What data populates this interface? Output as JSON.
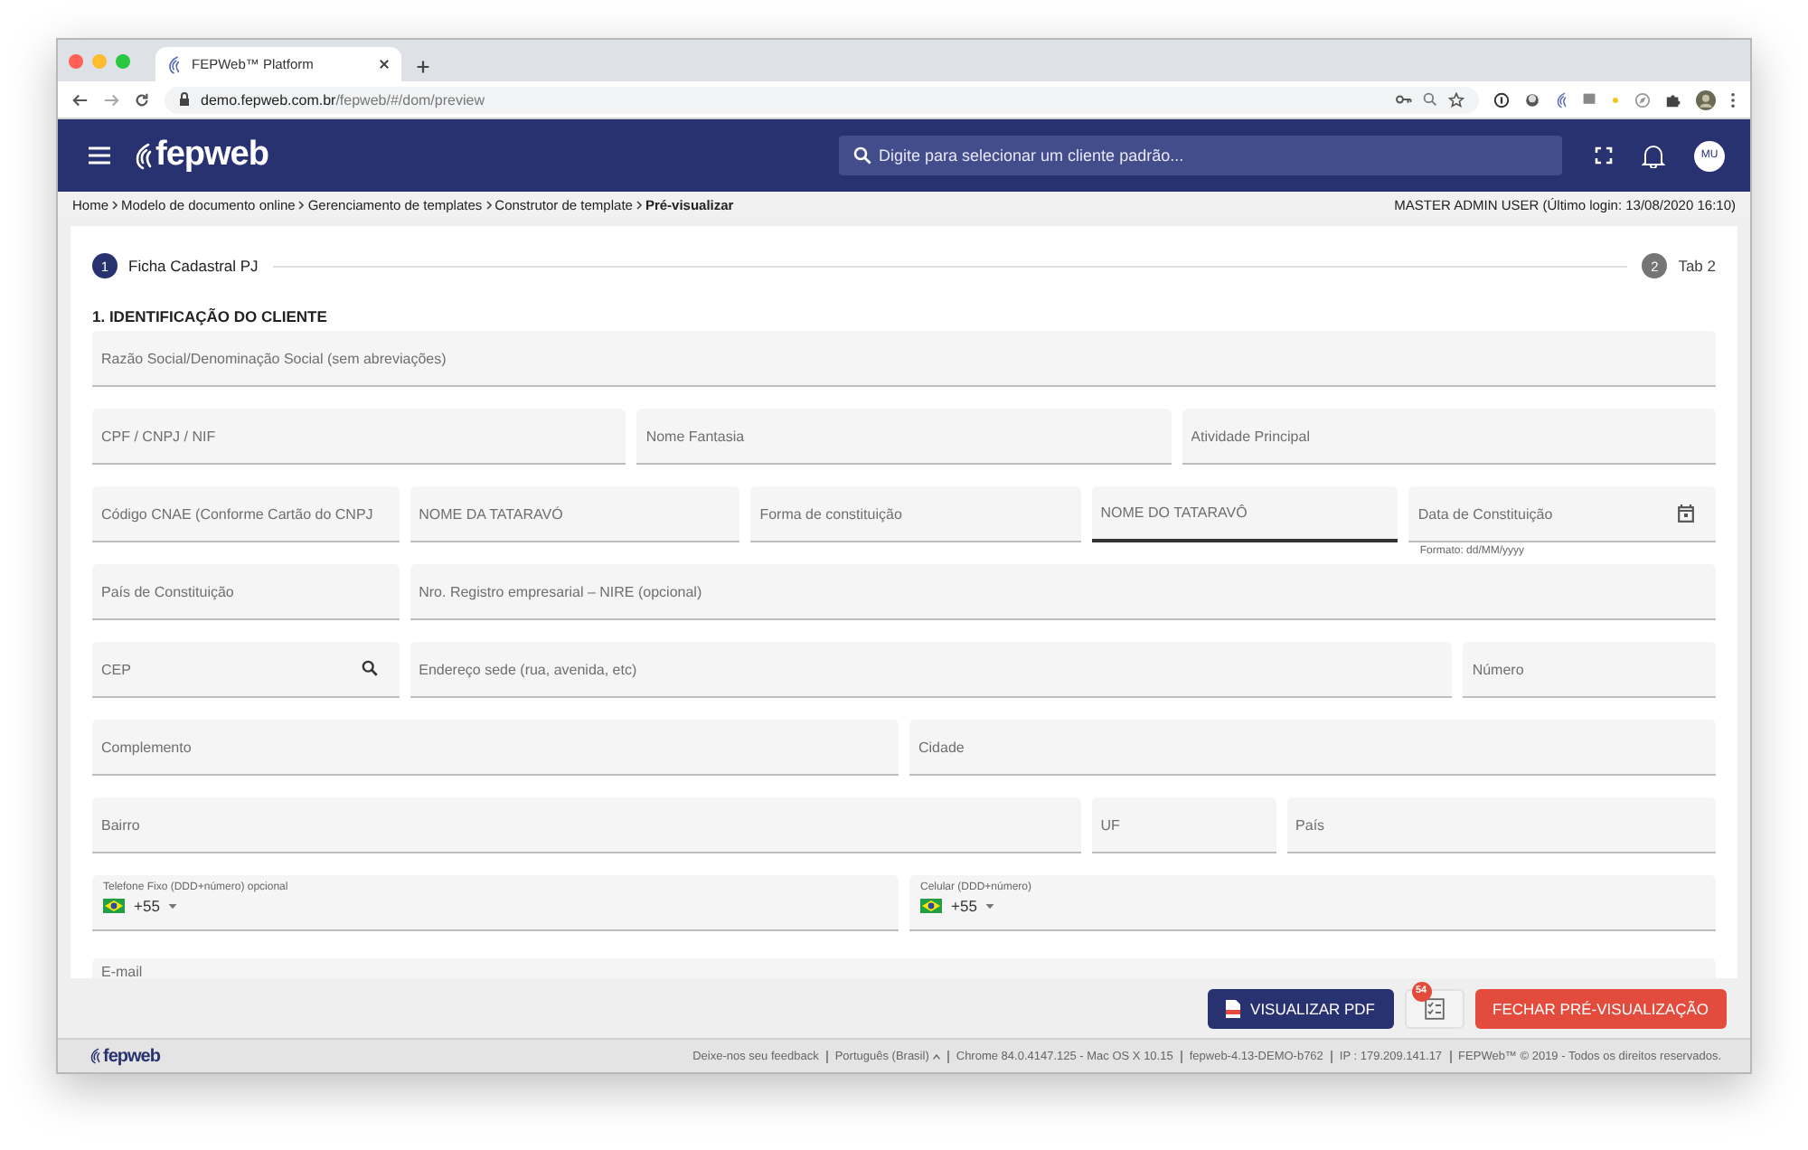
{
  "browser": {
    "tab_title": "FEPWeb™ Platform",
    "url_domain": "demo.fepweb.com.br",
    "url_path": "/fepweb/#/dom/preview"
  },
  "header": {
    "brand": "fepweb",
    "search_placeholder": "Digite para selecionar um cliente padrão...",
    "avatar": "MU"
  },
  "breadcrumb": {
    "items": [
      {
        "label": "Home",
        "current": false
      },
      {
        "label": "Modelo de documento online",
        "current": false
      },
      {
        "label": "Gerenciamento de templates",
        "current": false
      },
      {
        "label": "Construtor de template",
        "current": false
      },
      {
        "label": "Pré-visualizar",
        "current": true
      }
    ],
    "user_info": "MASTER ADMIN USER (Último login: 13/08/2020 16:10)"
  },
  "stepper": [
    {
      "number": "1",
      "label": "Ficha Cadastral PJ",
      "selected": true
    },
    {
      "number": "2",
      "label": "Tab 2",
      "selected": false
    }
  ],
  "section_title": "1. IDENTIFICAÇÃO DO CLIENTE",
  "form_rows": [
    [
      {
        "kind": "text",
        "placeholder": "Razão Social/Denominação Social (sem abreviações)",
        "focused": false
      }
    ],
    [
      {
        "kind": "text",
        "placeholder": "CPF / CNPJ / NIF",
        "focused": false
      },
      {
        "kind": "text",
        "placeholder": "Nome Fantasia",
        "focused": false
      },
      {
        "kind": "text",
        "placeholder": "Atividade Principal",
        "focused": false
      }
    ],
    [
      {
        "kind": "text",
        "placeholder": "Código CNAE (Conforme Cartão do CNPJ",
        "focused": false
      },
      {
        "kind": "text",
        "placeholder": "NOME DA TATARAVÓ",
        "focused": false
      },
      {
        "kind": "text",
        "placeholder": "Forma de constituição",
        "focused": false
      },
      {
        "kind": "text",
        "placeholder": "NOME DO TATARAVÔ",
        "focused": true
      },
      {
        "kind": "date",
        "placeholder": "Data de Constituição",
        "hint": "Formato: dd/MM/yyyy",
        "focused": false
      }
    ],
    [
      {
        "kind": "text",
        "placeholder": "País de Constituição",
        "focused": false
      },
      {
        "kind": "text",
        "placeholder": "Nro. Registro empresarial – NIRE (opcional)",
        "focused": false
      }
    ],
    [
      {
        "kind": "search",
        "placeholder": "CEP",
        "focused": false
      },
      {
        "kind": "text",
        "placeholder": "Endereço sede (rua, avenida, etc)",
        "focused": false
      },
      {
        "kind": "text",
        "placeholder": "Número",
        "focused": false
      }
    ],
    [
      {
        "kind": "text",
        "placeholder": "Complemento",
        "focused": false
      },
      {
        "kind": "text",
        "placeholder": "Cidade",
        "focused": false
      }
    ],
    [
      {
        "kind": "text",
        "placeholder": "Bairro",
        "focused": false
      },
      {
        "kind": "text",
        "placeholder": "UF",
        "focused": false
      },
      {
        "kind": "text",
        "placeholder": "País",
        "focused": false
      }
    ],
    [
      {
        "kind": "phone",
        "label": "Telefone Fixo (DDD+número) opcional",
        "dial_code": "+55",
        "focused": false
      },
      {
        "kind": "phone",
        "label": "Celular (DDD+número)",
        "dial_code": "+55",
        "focused": false
      }
    ],
    [
      {
        "kind": "text",
        "placeholder": "E-mail",
        "focused": false
      }
    ]
  ],
  "actions": {
    "pdf_button": "VISUALIZAR PDF",
    "checklist_badge": "54",
    "close_button": "FECHAR PRÉ-VISUALIZAÇÃO"
  },
  "footer": {
    "brand": "fepweb",
    "items": [
      {
        "kind": "link",
        "text": "Deixe-nos seu feedback"
      },
      {
        "kind": "dropdown",
        "text": "Português (Brasil)"
      },
      {
        "kind": "text",
        "text": "Chrome 84.0.4147.125 - Mac OS X 10.15"
      },
      {
        "kind": "text",
        "text": "fepweb-4.13-DEMO-b762"
      },
      {
        "kind": "text",
        "text": "IP : 179.209.141.17"
      },
      {
        "kind": "text",
        "text": "FEPWeb™ © 2019 - Todos os direitos reservados."
      }
    ]
  }
}
